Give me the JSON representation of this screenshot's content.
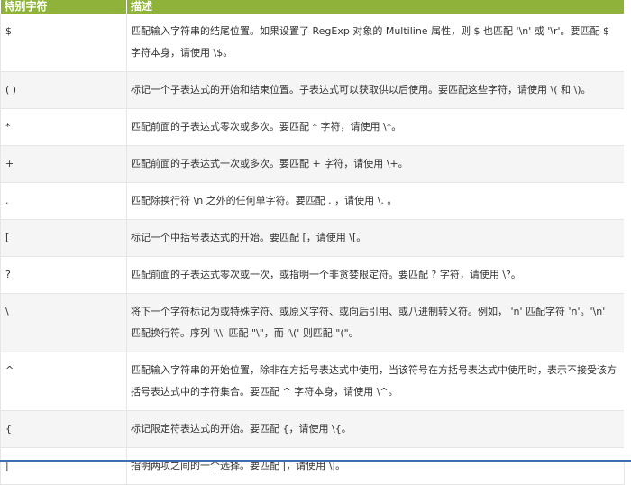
{
  "header": {
    "col1": "特别字符",
    "col2": "描述"
  },
  "rows": [
    {
      "char": "$",
      "desc": "匹配输入字符串的结尾位置。如果设置了 RegExp 对象的 Multiline 属性，则 $ 也匹配 '\\n' 或 '\\r'。要匹配 $ 字符本身，请使用 \\$。"
    },
    {
      "char": "( )",
      "desc": "标记一个子表达式的开始和结束位置。子表达式可以获取供以后使用。要匹配这些字符，请使用 \\( 和 \\)。"
    },
    {
      "char": "*",
      "desc": "匹配前面的子表达式零次或多次。要匹配 * 字符，请使用 \\*。"
    },
    {
      "char": "+",
      "desc": "匹配前面的子表达式一次或多次。要匹配 + 字符，请使用 \\+。"
    },
    {
      "char": ".",
      "desc": "匹配除换行符 \\n 之外的任何单字符。要匹配 . ，请使用 \\. 。"
    },
    {
      "char": "[",
      "desc": "标记一个中括号表达式的开始。要匹配 [，请使用 \\[。"
    },
    {
      "char": "?",
      "desc": "匹配前面的子表达式零次或一次，或指明一个非贪婪限定符。要匹配 ? 字符，请使用 \\?。"
    },
    {
      "char": "\\",
      "desc": "将下一个字符标记为或特殊字符、或原义字符、或向后引用、或八进制转义符。例如， 'n' 匹配字符 'n'。'\\n' 匹配换行符。序列 '\\\\' 匹配 \"\\\"，而 '\\(' 则匹配 \"(\"。"
    },
    {
      "char": "^",
      "desc": "匹配输入字符串的开始位置，除非在方括号表达式中使用，当该符号在方括号表达式中使用时，表示不接受该方括号表达式中的字符集合。要匹配 ^ 字符本身，请使用 \\^。"
    },
    {
      "char": "{",
      "desc": "标记限定符表达式的开始。要匹配 {，请使用 \\{。"
    },
    {
      "char": "|",
      "desc": "指明两项之间的一个选择。要匹配 |，请使用 \\|。"
    }
  ]
}
